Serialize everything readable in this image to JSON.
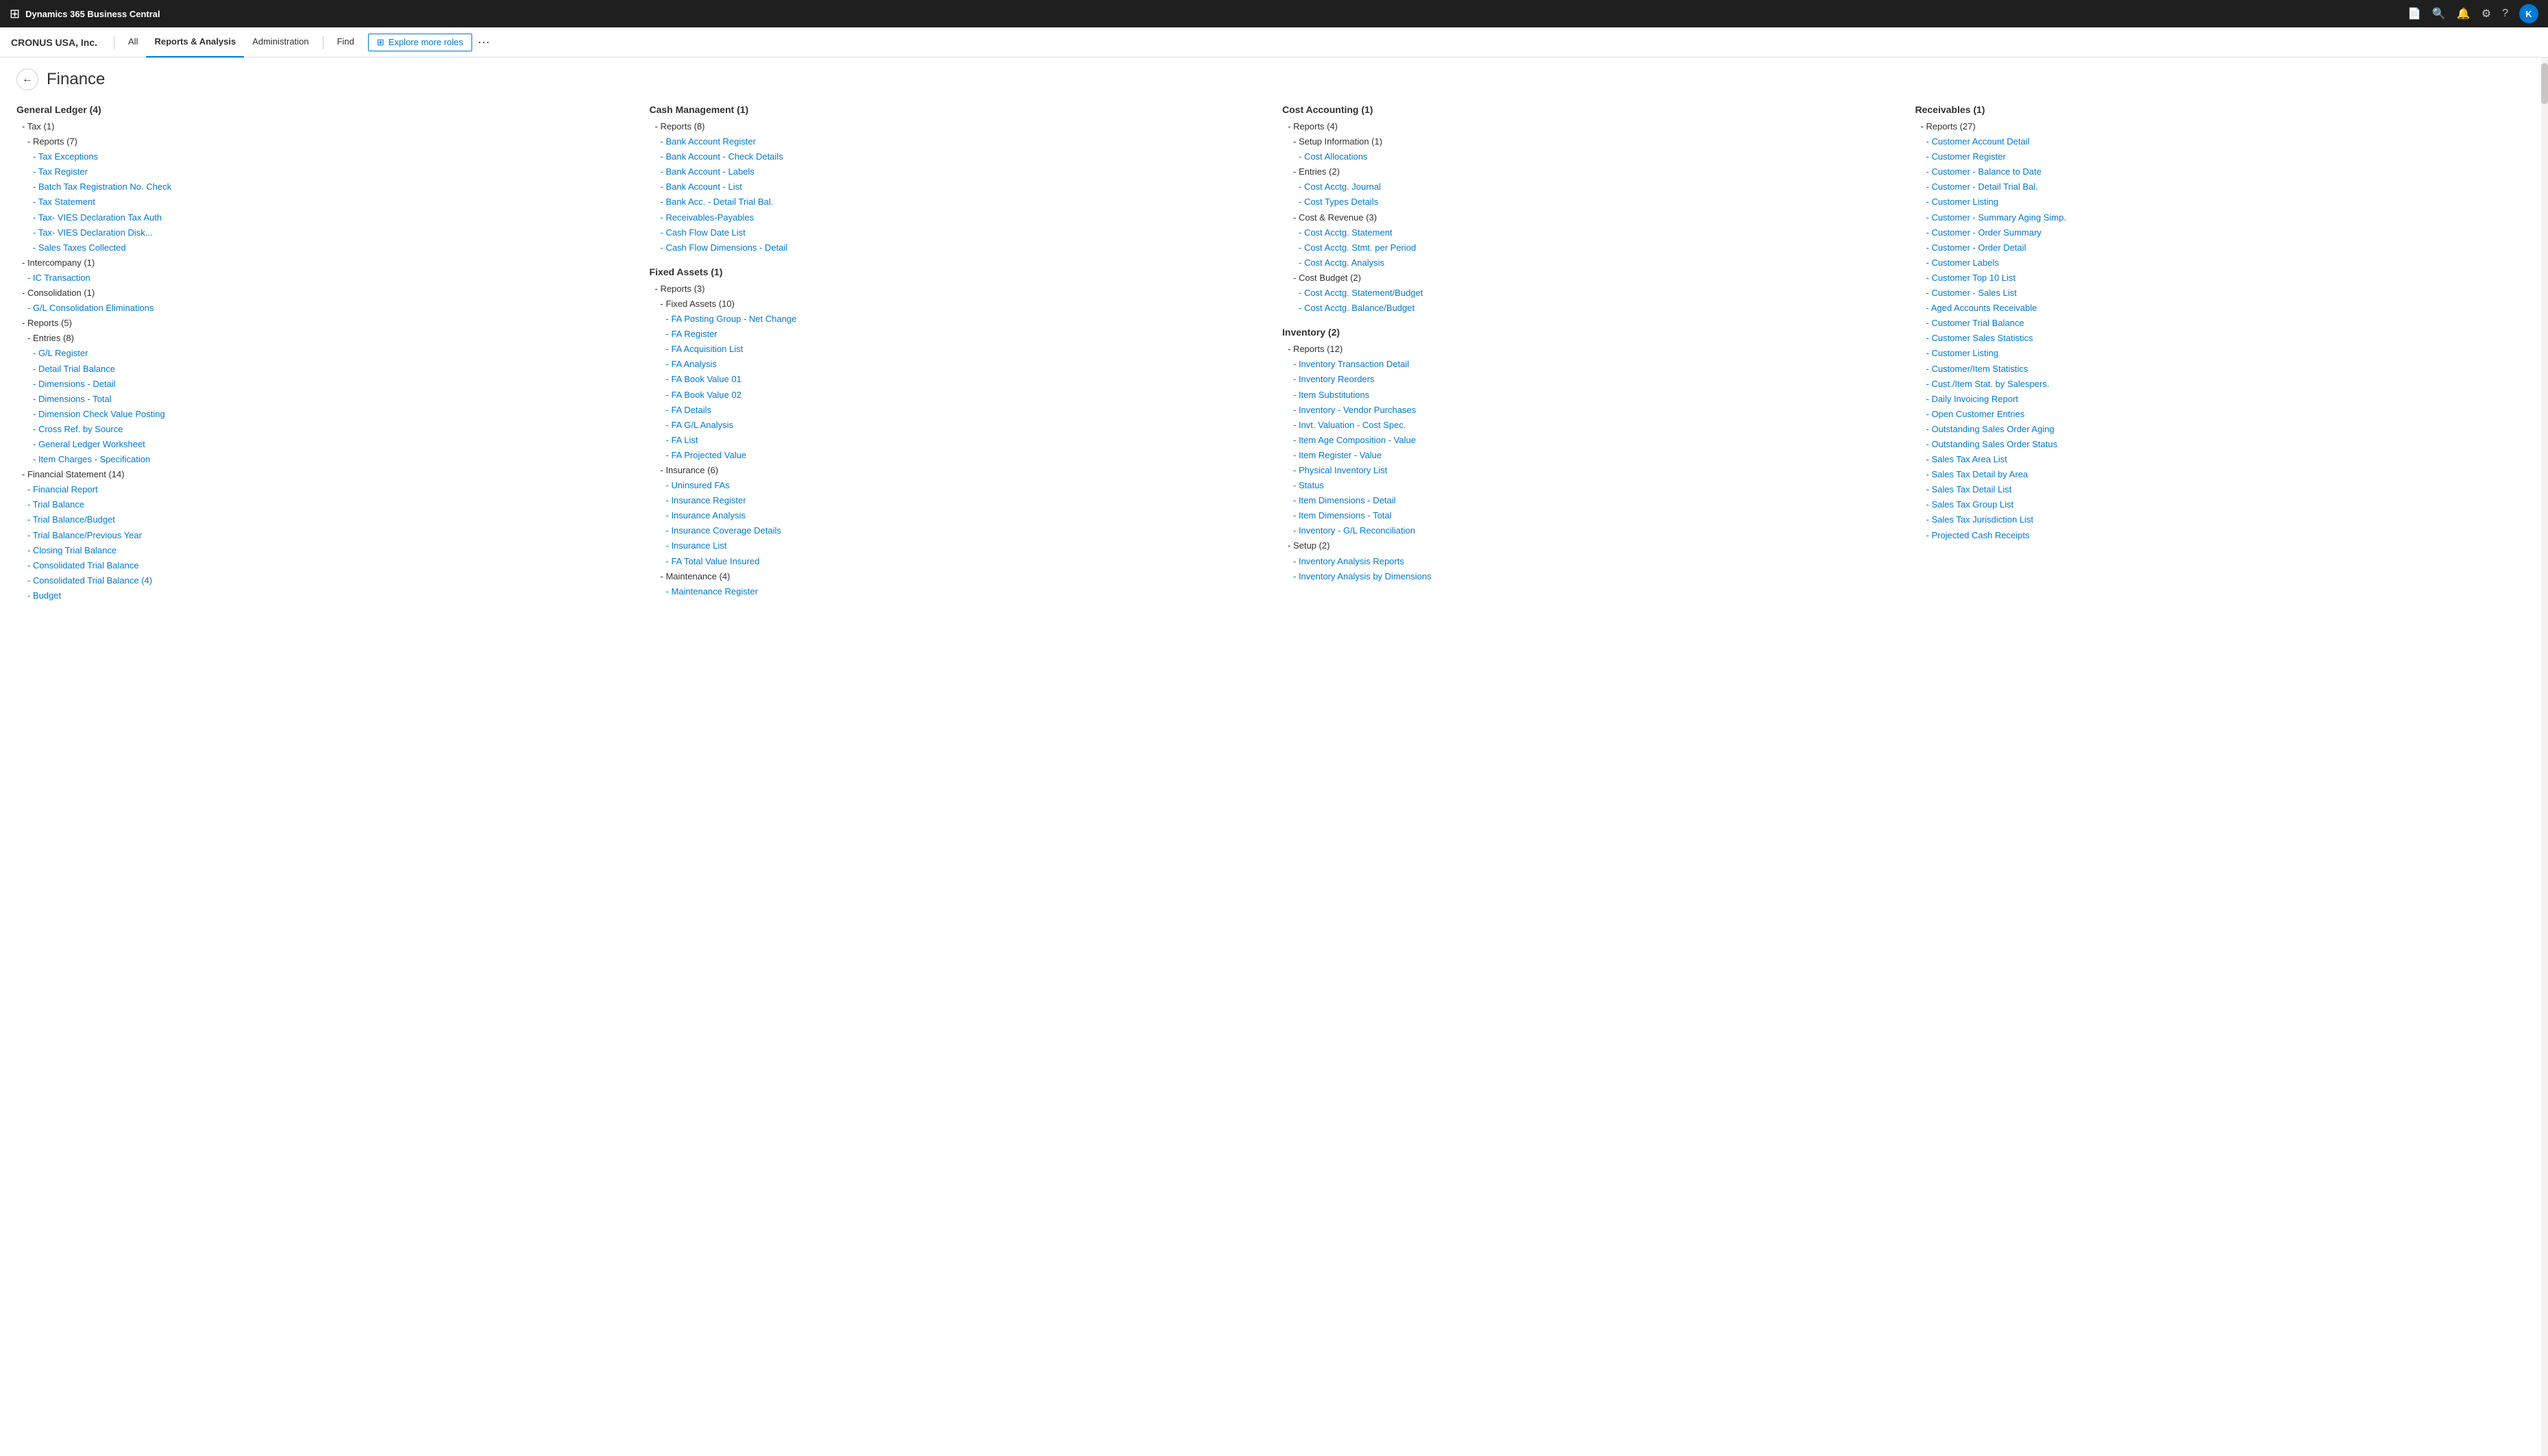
{
  "topBar": {
    "appName": "Dynamics 365 Business Central",
    "avatarLetter": "K"
  },
  "secondNav": {
    "companyName": "CRONUS USA, Inc.",
    "tabs": [
      "All",
      "Reports & Analysis",
      "Administration",
      "Find"
    ],
    "activeTab": "Reports & Analysis",
    "exploreBtn": "Explore more roles"
  },
  "page": {
    "title": "Finance",
    "backLabel": "←"
  },
  "columns": [
    {
      "id": "col1",
      "sections": [
        {
          "header": "General Ledger (4)",
          "items": [
            {
              "text": "- Tax (1)",
              "type": "cat sub"
            },
            {
              "text": "- Reports (7)",
              "type": "cat sub2"
            },
            {
              "text": "- Tax Exceptions",
              "type": "link sub3"
            },
            {
              "text": "- Tax Register",
              "type": "link sub3"
            },
            {
              "text": "- Batch Tax Registration No. Check",
              "type": "link sub3"
            },
            {
              "text": "- Tax Statement",
              "type": "link sub3"
            },
            {
              "text": "- Tax- VIES Declaration Tax Auth",
              "type": "link sub3"
            },
            {
              "text": "- Tax- VIES Declaration Disk...",
              "type": "link sub3"
            },
            {
              "text": "- Sales Taxes Collected",
              "type": "link sub3"
            },
            {
              "text": "- Intercompany (1)",
              "type": "cat sub"
            },
            {
              "text": "- IC Transaction",
              "type": "link sub2"
            },
            {
              "text": "- Consolidation (1)",
              "type": "cat sub"
            },
            {
              "text": "- G/L Consolidation Eliminations",
              "type": "link sub2"
            },
            {
              "text": "- Reports (5)",
              "type": "cat sub"
            },
            {
              "text": "- Entries (8)",
              "type": "cat sub2"
            },
            {
              "text": "- G/L Register",
              "type": "link sub3"
            },
            {
              "text": "- Detail Trial Balance",
              "type": "link sub3"
            },
            {
              "text": "- Dimensions - Detail",
              "type": "link sub3"
            },
            {
              "text": "- Dimensions - Total",
              "type": "link sub3"
            },
            {
              "text": "- Dimension Check Value Posting",
              "type": "link sub3"
            },
            {
              "text": "- Cross Ref. by Source",
              "type": "link sub3"
            },
            {
              "text": "- General Ledger Worksheet",
              "type": "link sub3"
            },
            {
              "text": "- Item Charges - Specification",
              "type": "link sub3"
            },
            {
              "text": "- Financial Statement (14)",
              "type": "cat sub"
            },
            {
              "text": "- Financial Report",
              "type": "link sub2"
            },
            {
              "text": "- Trial Balance",
              "type": "link sub2"
            },
            {
              "text": "- Trial Balance/Budget",
              "type": "link sub2"
            },
            {
              "text": "- Trial Balance/Previous Year",
              "type": "link sub2"
            },
            {
              "text": "- Closing Trial Balance",
              "type": "link sub2"
            },
            {
              "text": "- Consolidated Trial Balance",
              "type": "link sub2"
            },
            {
              "text": "- Consolidated Trial Balance (4)",
              "type": "link sub2"
            },
            {
              "text": "- Budget",
              "type": "link sub2"
            }
          ]
        }
      ]
    },
    {
      "id": "col2",
      "sections": [
        {
          "header": "Cash Management (1)",
          "items": [
            {
              "text": "- Reports (8)",
              "type": "cat sub"
            },
            {
              "text": "- Bank Account Register",
              "type": "link sub2"
            },
            {
              "text": "- Bank Account - Check Details",
              "type": "link sub2"
            },
            {
              "text": "- Bank Account - Labels",
              "type": "link sub2"
            },
            {
              "text": "- Bank Account - List",
              "type": "link sub2"
            },
            {
              "text": "- Bank Acc. - Detail Trial Bal.",
              "type": "link sub2"
            },
            {
              "text": "- Receivables-Payables",
              "type": "link sub2"
            },
            {
              "text": "- Cash Flow Date List",
              "type": "link sub2"
            },
            {
              "text": "- Cash Flow Dimensions - Detail",
              "type": "link sub2"
            }
          ]
        },
        {
          "header": "Fixed Assets (1)",
          "items": [
            {
              "text": "- Reports (3)",
              "type": "cat sub"
            },
            {
              "text": "- Fixed Assets (10)",
              "type": "cat sub2"
            },
            {
              "text": "- FA Posting Group - Net Change",
              "type": "link sub3"
            },
            {
              "text": "- FA Register",
              "type": "link sub3"
            },
            {
              "text": "- FA Acquisition List",
              "type": "link sub3"
            },
            {
              "text": "- FA Analysis",
              "type": "link sub3"
            },
            {
              "text": "- FA Book Value 01",
              "type": "link sub3"
            },
            {
              "text": "- FA Book Value 02",
              "type": "link sub3"
            },
            {
              "text": "- FA Details",
              "type": "link sub3"
            },
            {
              "text": "- FA G/L Analysis",
              "type": "link sub3"
            },
            {
              "text": "- FA List",
              "type": "link sub3"
            },
            {
              "text": "- FA Projected Value",
              "type": "link sub3"
            },
            {
              "text": "- Insurance (6)",
              "type": "cat sub2"
            },
            {
              "text": "- Uninsured FAs",
              "type": "link sub3"
            },
            {
              "text": "- Insurance Register",
              "type": "link sub3"
            },
            {
              "text": "- Insurance Analysis",
              "type": "link sub3"
            },
            {
              "text": "- Insurance Coverage Details",
              "type": "link sub3"
            },
            {
              "text": "- Insurance List",
              "type": "link sub3"
            },
            {
              "text": "- FA Total Value Insured",
              "type": "link sub3"
            },
            {
              "text": "- Maintenance (4)",
              "type": "cat sub2"
            },
            {
              "text": "- Maintenance Register",
              "type": "link sub3"
            }
          ]
        }
      ]
    },
    {
      "id": "col3",
      "sections": [
        {
          "header": "Cost Accounting (1)",
          "items": [
            {
              "text": "- Reports (4)",
              "type": "cat sub"
            },
            {
              "text": "- Setup Information (1)",
              "type": "cat sub2"
            },
            {
              "text": "- Cost Allocations",
              "type": "link sub3"
            },
            {
              "text": "- Entries (2)",
              "type": "cat sub2"
            },
            {
              "text": "- Cost Acctg. Journal",
              "type": "link sub3"
            },
            {
              "text": "- Cost Types Details",
              "type": "link sub3"
            },
            {
              "text": "- Cost & Revenue (3)",
              "type": "cat sub2"
            },
            {
              "text": "- Cost Acctg. Statement",
              "type": "link sub3"
            },
            {
              "text": "- Cost Acctg. Stmt. per Period",
              "type": "link sub3"
            },
            {
              "text": "- Cost Acctg. Analysis",
              "type": "link sub3"
            },
            {
              "text": "- Cost Budget (2)",
              "type": "cat sub2"
            },
            {
              "text": "- Cost Acctg. Statement/Budget",
              "type": "link sub3"
            },
            {
              "text": "- Cost Acctg. Balance/Budget",
              "type": "link sub3"
            }
          ]
        },
        {
          "header": "Inventory (2)",
          "items": [
            {
              "text": "- Reports (12)",
              "type": "cat sub"
            },
            {
              "text": "- Inventory Transaction Detail",
              "type": "link sub2"
            },
            {
              "text": "- Inventory Reorders",
              "type": "link sub2"
            },
            {
              "text": "- Item Substitutions",
              "type": "link sub2"
            },
            {
              "text": "- Inventory - Vendor Purchases",
              "type": "link sub2"
            },
            {
              "text": "- Invt. Valuation - Cost Spec.",
              "type": "link sub2"
            },
            {
              "text": "- Item Age Composition - Value",
              "type": "link sub2"
            },
            {
              "text": "- Item Register - Value",
              "type": "link sub2"
            },
            {
              "text": "- Physical Inventory List",
              "type": "link sub2"
            },
            {
              "text": "- Status",
              "type": "link sub2"
            },
            {
              "text": "- Item Dimensions - Detail",
              "type": "link sub2"
            },
            {
              "text": "- Item Dimensions - Total",
              "type": "link sub2"
            },
            {
              "text": "- Inventory - G/L Reconciliation",
              "type": "link sub2"
            },
            {
              "text": "- Setup (2)",
              "type": "cat sub"
            },
            {
              "text": "- Inventory Analysis Reports",
              "type": "link sub2"
            },
            {
              "text": "- Inventory Analysis by Dimensions",
              "type": "link sub2"
            }
          ]
        }
      ]
    },
    {
      "id": "col4",
      "sections": [
        {
          "header": "Receivables (1)",
          "items": [
            {
              "text": "- Reports (27)",
              "type": "cat sub"
            },
            {
              "text": "- Customer Account Detail",
              "type": "link sub2"
            },
            {
              "text": "- Customer Register",
              "type": "link sub2"
            },
            {
              "text": "- Customer - Balance to Date",
              "type": "link sub2"
            },
            {
              "text": "- Customer - Detail Trial Bal.",
              "type": "link sub2"
            },
            {
              "text": "- Customer Listing",
              "type": "link sub2"
            },
            {
              "text": "- Customer - Summary Aging Simp.",
              "type": "link sub2"
            },
            {
              "text": "- Customer - Order Summary",
              "type": "link sub2"
            },
            {
              "text": "- Customer - Order Detail",
              "type": "link sub2"
            },
            {
              "text": "- Customer Labels",
              "type": "link sub2"
            },
            {
              "text": "- Customer Top 10 List",
              "type": "link sub2"
            },
            {
              "text": "- Customer - Sales List",
              "type": "link sub2"
            },
            {
              "text": "- Aged Accounts Receivable",
              "type": "link sub2"
            },
            {
              "text": "- Customer Trial Balance",
              "type": "link sub2"
            },
            {
              "text": "- Customer Sales Statistics",
              "type": "link sub2"
            },
            {
              "text": "- Customer Listing",
              "type": "link sub2"
            },
            {
              "text": "- Customer/Item Statistics",
              "type": "link sub2"
            },
            {
              "text": "- Cust./Item Stat. by Salespers.",
              "type": "link sub2"
            },
            {
              "text": "- Daily Invoicing Report",
              "type": "link sub2"
            },
            {
              "text": "- Open Customer Entries",
              "type": "link sub2"
            },
            {
              "text": "- Outstanding Sales Order Aging",
              "type": "link sub2"
            },
            {
              "text": "- Outstanding Sales Order Status",
              "type": "link sub2"
            },
            {
              "text": "- Sales Tax Area List",
              "type": "link sub2"
            },
            {
              "text": "- Sales Tax Detail by Area",
              "type": "link sub2"
            },
            {
              "text": "- Sales Tax Detail List",
              "type": "link sub2"
            },
            {
              "text": "- Sales Tax Group List",
              "type": "link sub2"
            },
            {
              "text": "- Sales Tax Jurisdiction List",
              "type": "link sub2"
            },
            {
              "text": "- Projected Cash Receipts",
              "type": "link sub2"
            }
          ]
        }
      ]
    }
  ]
}
